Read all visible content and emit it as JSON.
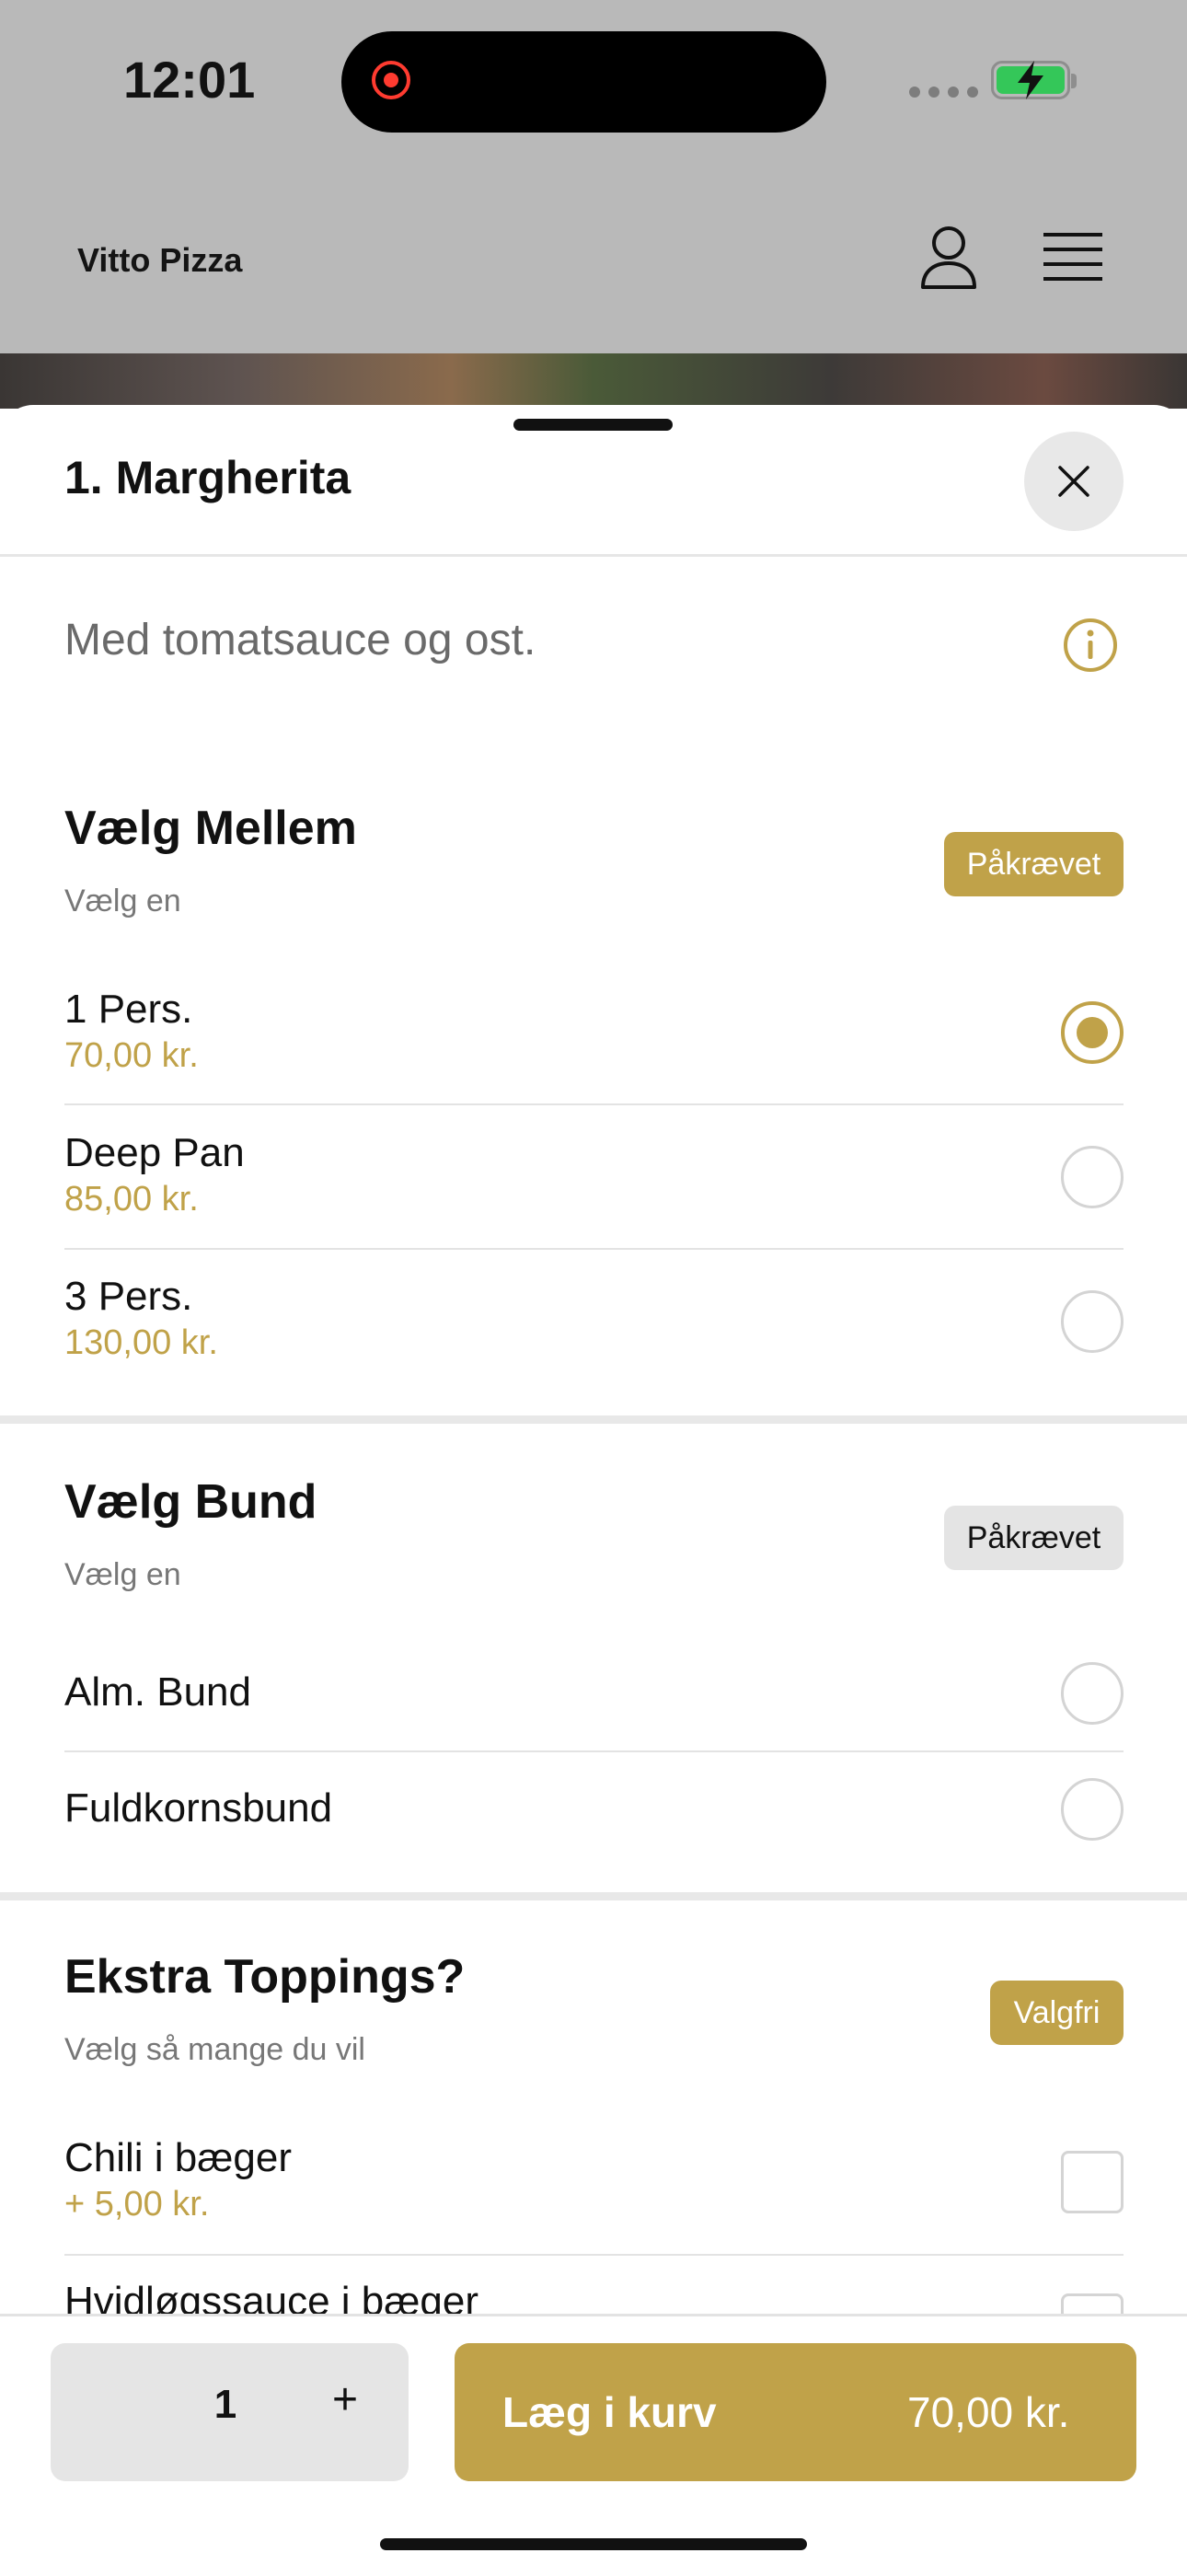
{
  "status_bar": {
    "time": "12:01"
  },
  "header": {
    "brand": "Vitto Pizza"
  },
  "sheet": {
    "title": "1. Margherita",
    "description": "Med tomatsauce og ost."
  },
  "groups": [
    {
      "title": "Vælg Mellem",
      "subtitle": "Vælg en",
      "badge": "Påkrævet",
      "options": [
        {
          "name": "1 Pers.",
          "price": "70,00 kr.",
          "selected": true
        },
        {
          "name": "Deep Pan",
          "price": "85,00 kr.",
          "selected": false
        },
        {
          "name": "3 Pers.",
          "price": "130,00 kr.",
          "selected": false
        }
      ]
    },
    {
      "title": "Vælg Bund",
      "subtitle": "Vælg en",
      "badge": "Påkrævet",
      "options": [
        {
          "name": "Alm. Bund",
          "selected": false
        },
        {
          "name": "Fuldkornsbund",
          "selected": false
        }
      ]
    },
    {
      "title": "Ekstra Toppings?",
      "subtitle": "Vælg så mange du vil",
      "badge": "Valgfri",
      "options": [
        {
          "name": "Chili i bæger",
          "price": "+ 5,00 kr.",
          "checked": false
        },
        {
          "name": "Hvidløgssauce i bæger",
          "checked": false
        }
      ]
    }
  ],
  "footer": {
    "quantity": "1",
    "plus": "+",
    "add_label": "Læg i kurv",
    "total": "70,00 kr."
  },
  "colors": {
    "accent": "#c0a249",
    "header_dim": "#b9b9b9"
  }
}
